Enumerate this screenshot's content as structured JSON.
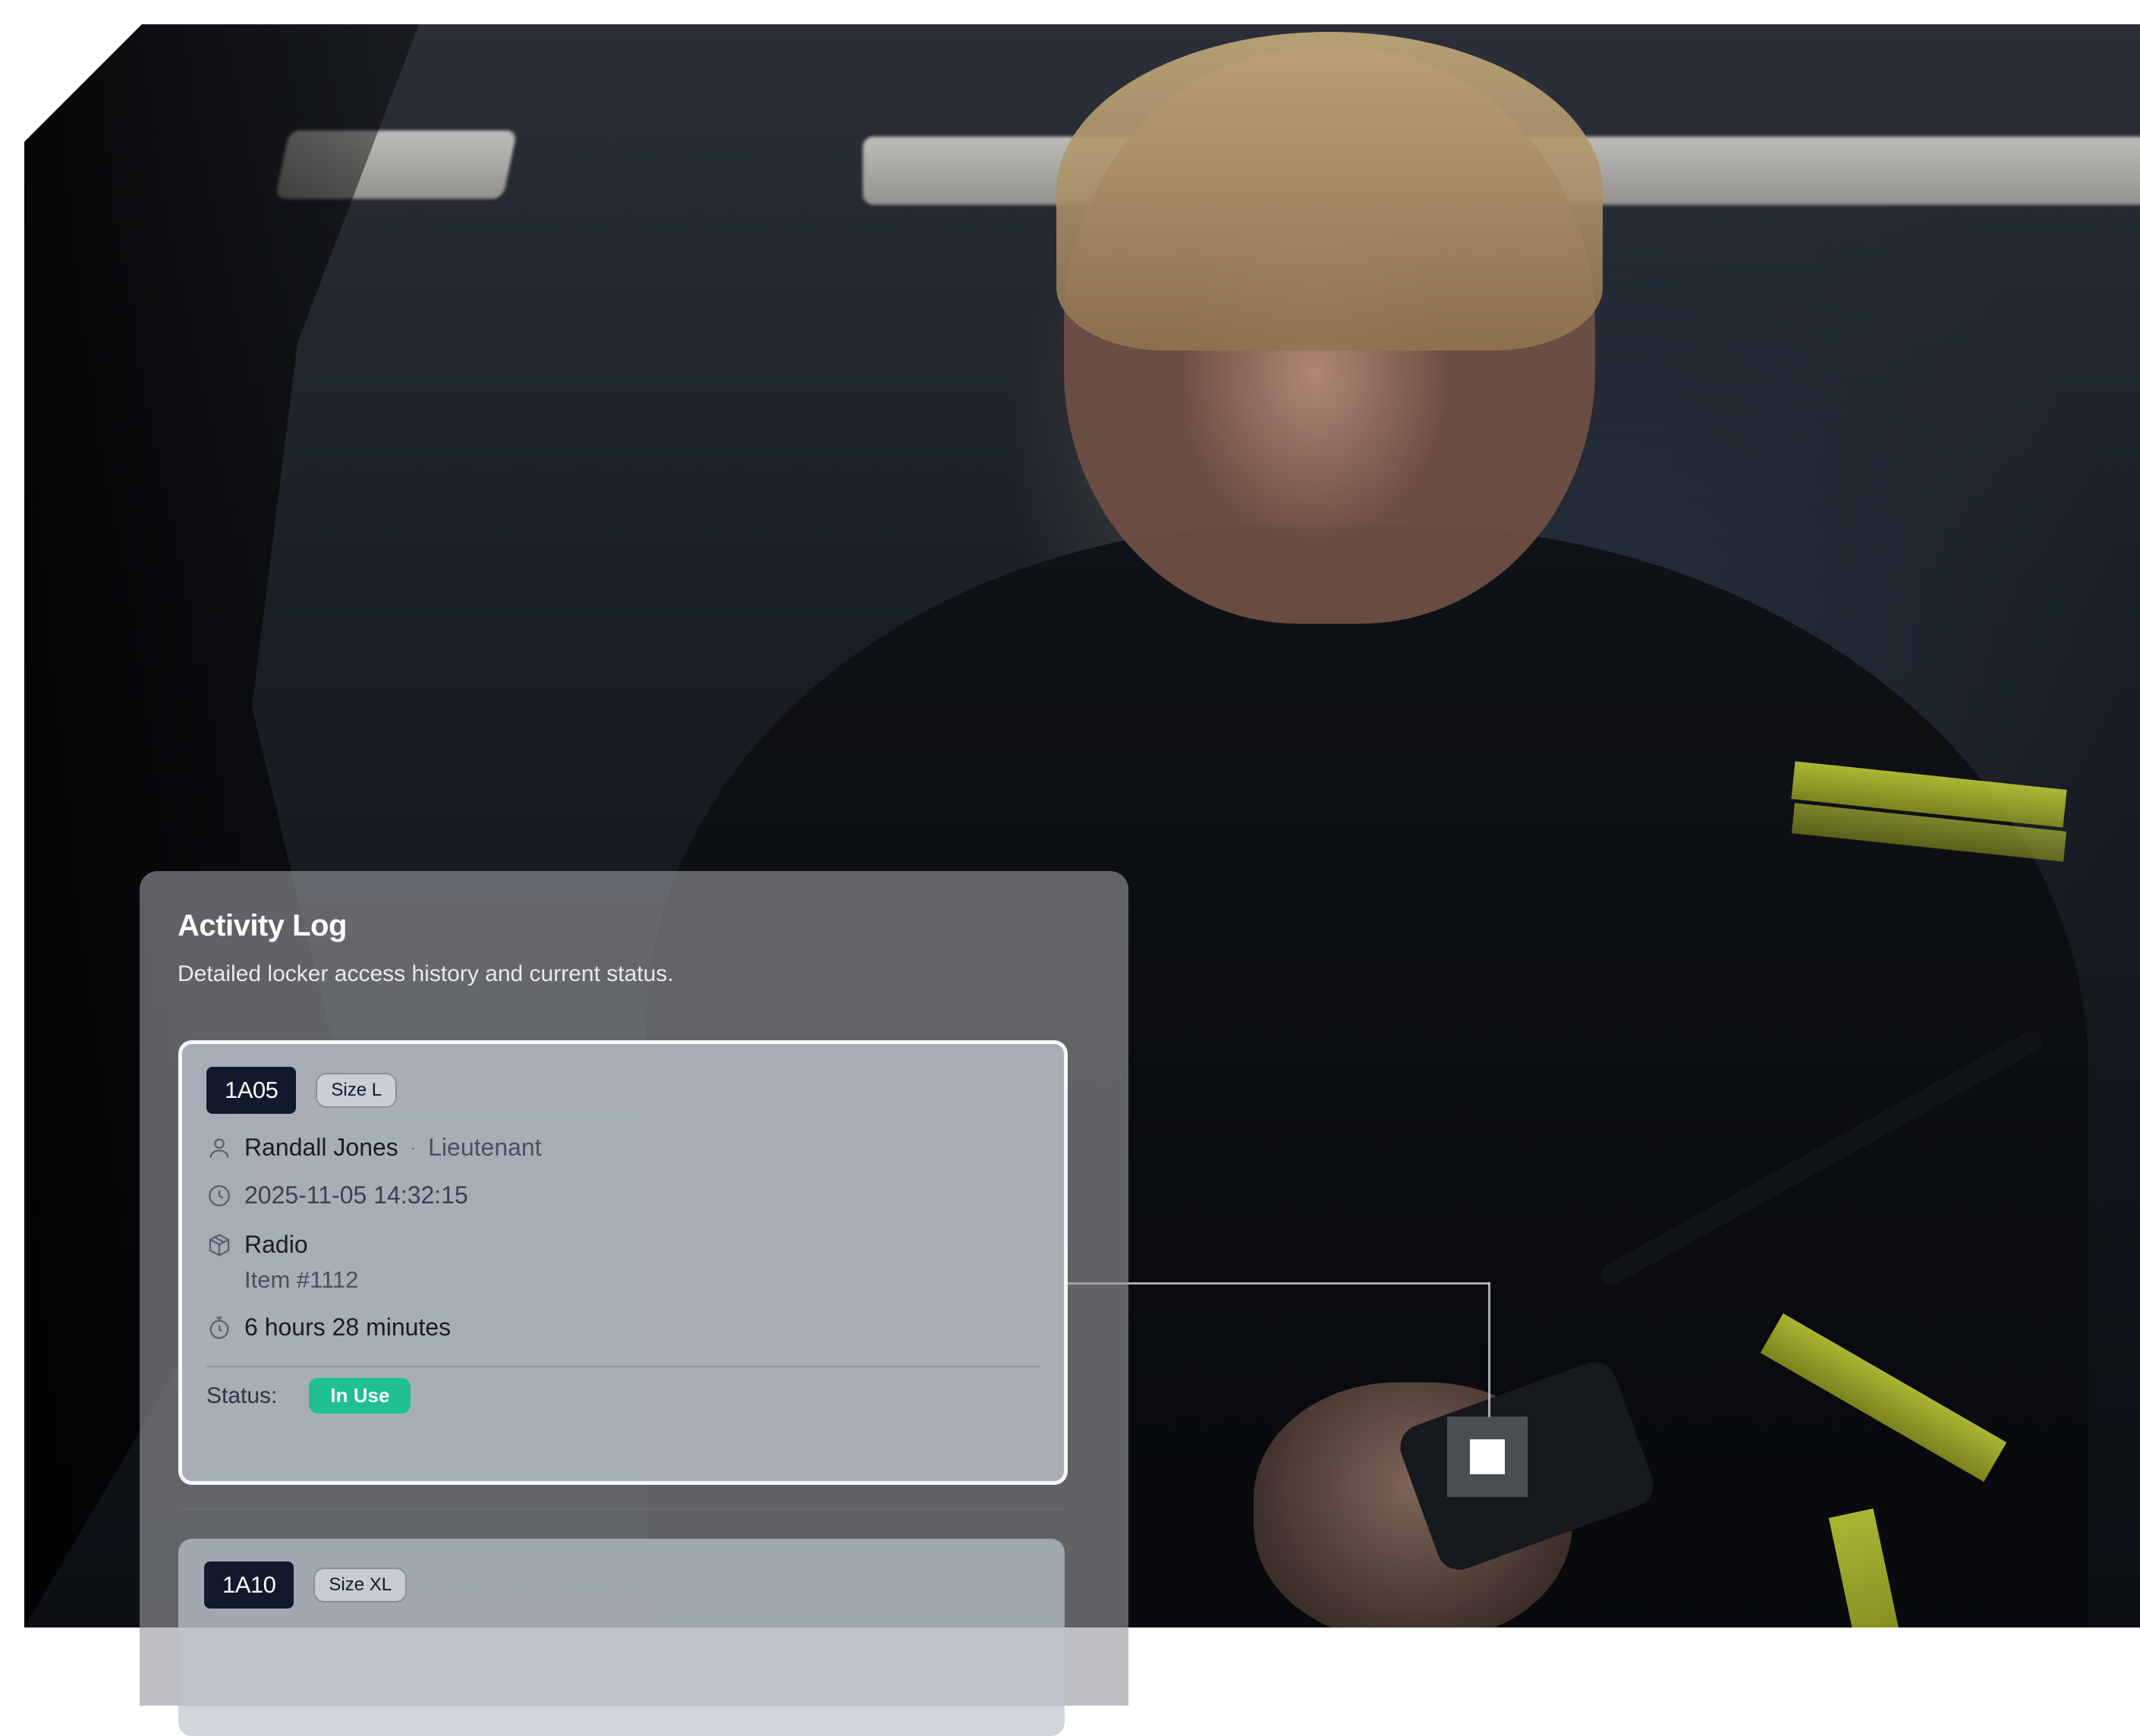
{
  "panel": {
    "title": "Activity Log",
    "subtitle": "Detailed locker access history and current status."
  },
  "records": [
    {
      "locker_id": "1A05",
      "size": "Size L",
      "user_name": "Randall Jones",
      "separator": "·",
      "role": "Lieutenant",
      "timestamp": "2025-11-05 14:32:15",
      "item_name": "Radio",
      "item_number": "Item #1112",
      "duration": "6 hours 28 minutes",
      "status_label": "Status:",
      "status": "In Use"
    },
    {
      "locker_id": "1A10",
      "size": "Size XL"
    }
  ],
  "icons": {
    "user": "user-icon",
    "clock": "clock-icon",
    "item": "cube-icon",
    "duration": "stopwatch-icon"
  },
  "colors": {
    "locker_id_bg": "#111a2c",
    "status_in_use": "#1fbf93",
    "card_border_active": "#f4f6fa",
    "hotspot_marker": "#ffffff"
  }
}
